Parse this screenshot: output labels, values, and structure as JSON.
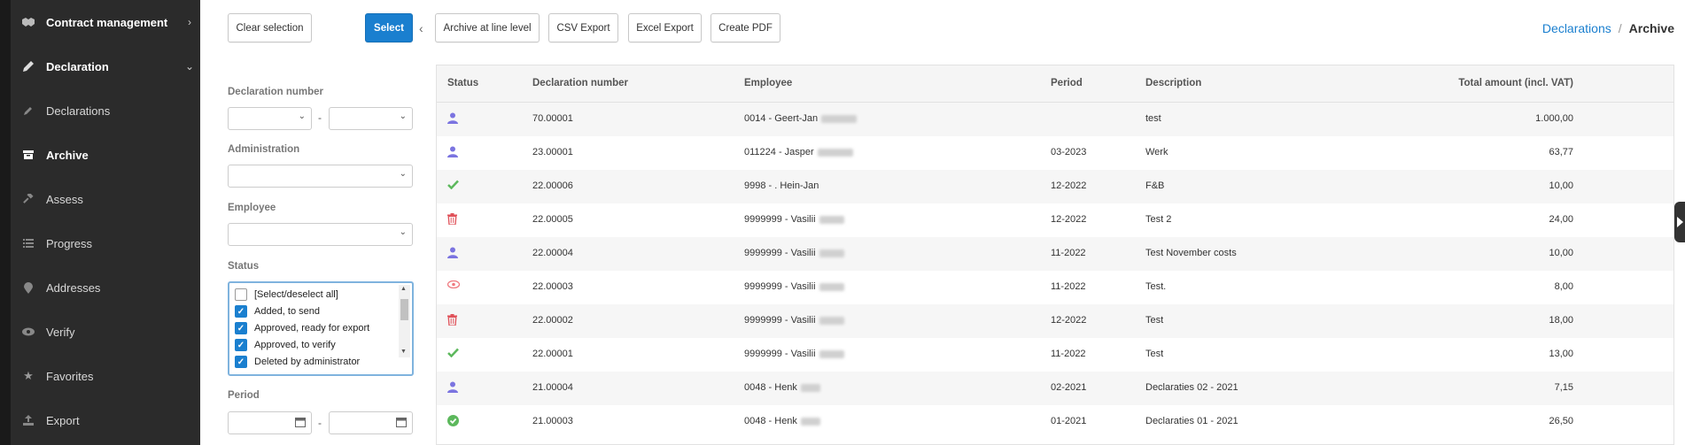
{
  "sidebar": {
    "items": [
      {
        "label": "Contract management",
        "icon": "handshake-icon",
        "chev": "›"
      },
      {
        "label": "Declaration",
        "icon": "pencil-icon",
        "chev": "⌄"
      },
      {
        "label": "Declarations",
        "icon": "pencil-small-icon"
      },
      {
        "label": "Archive",
        "icon": "archive-icon"
      },
      {
        "label": "Assess",
        "icon": "gavel-icon"
      },
      {
        "label": "Progress",
        "icon": "list-icon"
      },
      {
        "label": "Addresses",
        "icon": "map-pin-icon"
      },
      {
        "label": "Verify",
        "icon": "eye-icon"
      },
      {
        "label": "Favorites",
        "icon": "star-icon"
      },
      {
        "label": "Export",
        "icon": "export-icon"
      }
    ]
  },
  "toolbar": {
    "clear_selection": "Clear selection",
    "select": "Select",
    "archive_line": "Archive at line level",
    "csv_export": "CSV Export",
    "excel_export": "Excel Export",
    "create_pdf": "Create PDF"
  },
  "breadcrumb": {
    "link": "Declarations",
    "sep": "/",
    "current": "Archive"
  },
  "filters": {
    "declaration_number": "Declaration number",
    "dash": "-",
    "administration": "Administration",
    "employee": "Employee",
    "status": "Status",
    "period": "Period",
    "status_options": [
      {
        "label": "[Select/deselect all]",
        "checked": false
      },
      {
        "label": "Added, to send",
        "checked": true
      },
      {
        "label": "Approved, ready for export",
        "checked": true
      },
      {
        "label": "Approved, to verify",
        "checked": true
      },
      {
        "label": "Deleted by administrator",
        "checked": true
      }
    ]
  },
  "table": {
    "headers": {
      "status": "Status",
      "number": "Declaration number",
      "employee": "Employee",
      "period": "Period",
      "description": "Description",
      "total": "Total amount (incl. VAT)"
    },
    "rows": [
      {
        "status": "user",
        "number": "70.00001",
        "employee": "0014 - Geert-Jan",
        "period": "",
        "description": "test",
        "total": "1.000,00"
      },
      {
        "status": "user",
        "number": "23.00001",
        "employee": "011224 - Jasper",
        "period": "03-2023",
        "description": "Werk",
        "total": "63,77"
      },
      {
        "status": "check",
        "number": "22.00006",
        "employee": "9998 - . Hein-Jan",
        "period": "12-2022",
        "description": "F&B",
        "total": "10,00"
      },
      {
        "status": "trash",
        "number": "22.00005",
        "employee": "9999999 - Vasilii",
        "period": "12-2022",
        "description": "Test 2",
        "total": "24,00"
      },
      {
        "status": "user",
        "number": "22.00004",
        "employee": "9999999 - Vasilii",
        "period": "11-2022",
        "description": "Test November costs",
        "total": "10,00"
      },
      {
        "status": "eye",
        "number": "22.00003",
        "employee": "9999999 - Vasilii",
        "period": "11-2022",
        "description": "Test.",
        "total": "8,00"
      },
      {
        "status": "trash",
        "number": "22.00002",
        "employee": "9999999 - Vasilii",
        "period": "12-2022",
        "description": "Test",
        "total": "18,00"
      },
      {
        "status": "check",
        "number": "22.00001",
        "employee": "9999999 - Vasilii",
        "period": "11-2022",
        "description": "Test",
        "total": "13,00"
      },
      {
        "status": "user",
        "number": "21.00004",
        "employee": "0048 - Henk",
        "period": "02-2021",
        "description": "Declaraties 02 - 2021",
        "total": "7,15"
      },
      {
        "status": "check-circle",
        "number": "21.00003",
        "employee": "0048 - Henk",
        "period": "01-2021",
        "description": "Declaraties 01 - 2021",
        "total": "26,50"
      }
    ]
  },
  "colors": {
    "accent": "#1a7fcf",
    "user": "#7b74e0",
    "check": "#5cb85c",
    "trash": "#e0525a",
    "eye": "#ef7a80"
  }
}
